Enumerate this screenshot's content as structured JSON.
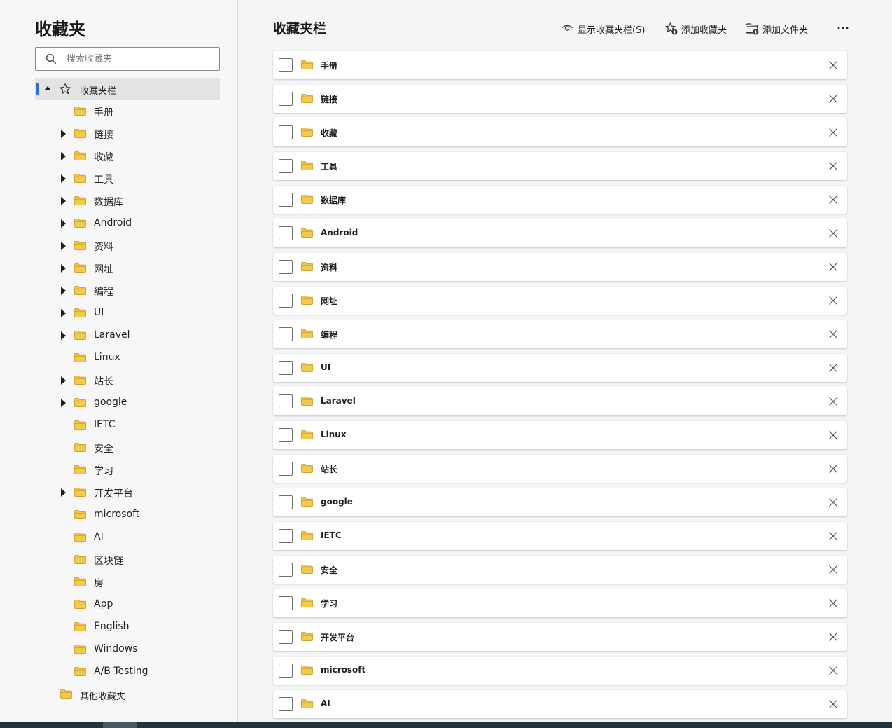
{
  "sidebar": {
    "title": "收藏夹",
    "search": {
      "placeholder": "搜索收藏夹",
      "value": ""
    },
    "root": {
      "label": "收藏夹栏",
      "expanded": true,
      "selected": true
    },
    "items": [
      {
        "label": "手册",
        "has_children": false
      },
      {
        "label": "链接",
        "has_children": true
      },
      {
        "label": "收藏",
        "has_children": true
      },
      {
        "label": "工具",
        "has_children": true
      },
      {
        "label": "数据库",
        "has_children": true
      },
      {
        "label": "Android",
        "has_children": true
      },
      {
        "label": "资料",
        "has_children": true
      },
      {
        "label": "网址",
        "has_children": true
      },
      {
        "label": "编程",
        "has_children": true
      },
      {
        "label": "UI",
        "has_children": true
      },
      {
        "label": "Laravel",
        "has_children": true
      },
      {
        "label": "Linux",
        "has_children": false
      },
      {
        "label": "站长",
        "has_children": true
      },
      {
        "label": "google",
        "has_children": true
      },
      {
        "label": "IETC",
        "has_children": false
      },
      {
        "label": "安全",
        "has_children": false
      },
      {
        "label": "学习",
        "has_children": false
      },
      {
        "label": "开发平台",
        "has_children": true
      },
      {
        "label": "microsoft",
        "has_children": false
      },
      {
        "label": "AI",
        "has_children": false
      },
      {
        "label": "区块链",
        "has_children": false
      },
      {
        "label": "房",
        "has_children": false
      },
      {
        "label": "App",
        "has_children": false
      },
      {
        "label": "English",
        "has_children": false
      },
      {
        "label": "Windows",
        "has_children": false
      },
      {
        "label": "A/B Testing",
        "has_children": false
      }
    ],
    "other": {
      "label": "其他收藏夹"
    }
  },
  "main": {
    "title": "收藏夹栏",
    "toolbar": {
      "show_bar_label": "显示收藏夹栏(S)",
      "add_favorite_label": "添加收藏夹",
      "add_folder_label": "添加文件夹",
      "more_icon": "more-horizontal-icon"
    },
    "rows": [
      "手册",
      "链接",
      "收藏",
      "工具",
      "数据库",
      "Android",
      "资料",
      "网址",
      "编程",
      "UI",
      "Laravel",
      "Linux",
      "站长",
      "google",
      "IETC",
      "安全",
      "学习",
      "开发平台",
      "microsoft",
      "AI"
    ]
  },
  "colors": {
    "accent": "#2f6fd1",
    "folder_fill": "#f3c94e",
    "folder_stroke": "#c99a1e",
    "sidebar_bg": "#f7f7f7",
    "selected_bg": "#e3e3e3"
  },
  "icons": {
    "search": "search-icon",
    "star": "star-icon",
    "folder": "folder-icon",
    "eye": "eye-icon",
    "add_star": "add-favorite-icon",
    "add_folder": "add-folder-icon",
    "close": "close-icon",
    "caret_right": "caret-right-icon",
    "caret_down": "caret-down-icon"
  }
}
